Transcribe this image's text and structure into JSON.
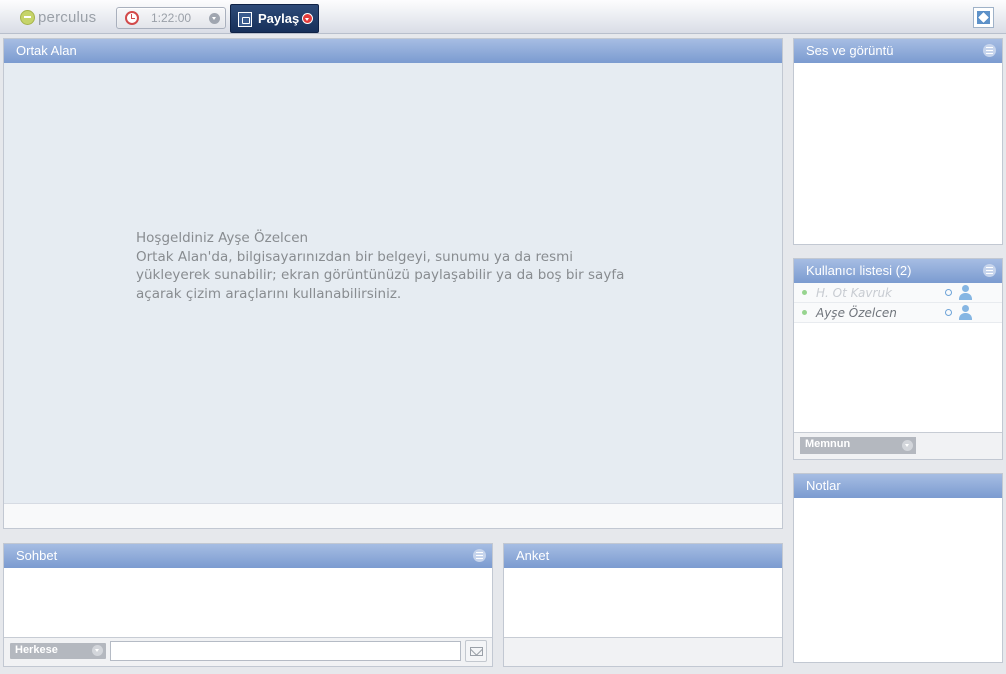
{
  "topbar": {
    "logo_text": "perculus",
    "timer_value": "1:22:00",
    "share_label": "Paylaş"
  },
  "shared_area": {
    "title": "Ortak Alan",
    "welcome_line1": "Hoşgeldiniz Ayşe Özelcen",
    "welcome_line2": "Ortak Alan'da, bilgisayarınızdan bir belgeyi, sunumu ya da resmi",
    "welcome_line3": "yükleyerek sunabilir; ekran görüntünüzü paylaşabilir ya da boş bir sayfa",
    "welcome_line4": "açarak çizim araçlarını kullanabilirsiniz."
  },
  "chat": {
    "title": "Sohbet",
    "recipient_label": "Herkese",
    "input_value": ""
  },
  "poll": {
    "title": "Anket"
  },
  "av": {
    "title": "Ses ve görüntü"
  },
  "users": {
    "title": "Kullanıcı listesi (2)",
    "items": [
      {
        "name": "H. Ot Kavruk",
        "online_color": "#97d48f"
      },
      {
        "name": "Ayşe Özelcen",
        "online_color": "#97d48f"
      }
    ],
    "mood_label": "Memnun"
  },
  "notes": {
    "title": "Notlar"
  },
  "colors": {
    "header_blue": "#7b9bd0",
    "share_navy": "#17305a",
    "canvas_bg": "#e6ecf2",
    "online_green": "#97d48f"
  }
}
